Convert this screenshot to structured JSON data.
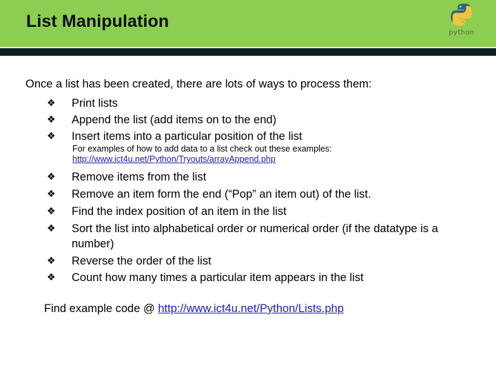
{
  "header": {
    "title": "List Manipulation",
    "band_color": "#8CCE52",
    "bar_color": "#0E1F24",
    "logo": {
      "name": "python-logo",
      "wordmark": "python"
    }
  },
  "slide": {
    "intro": "Once a list has been created, there are lots of ways to process them:",
    "bullet_glyph": "❖",
    "bullets_top": [
      "Print lists",
      "Append the list (add items on to the end)",
      "Insert items into a particular position of the list"
    ],
    "subnote": {
      "text": "For examples of how to add data to a list check out these examples:",
      "link": "http://www.ict4u.net/Python/Tryouts/arrayAppend.php"
    },
    "bullets_bottom": [
      "Remove items from the list",
      "Remove an item form the end (“Pop” an item out) of the list.",
      "Find the index position of an item in the list",
      "Sort the list into alphabetical order or numerical order (if the datatype is a number)",
      "Reverse the order of the list",
      "Count how many times a particular item appears in the list"
    ],
    "footer": {
      "prefix": "Find example code @ ",
      "link": "http://www.ict4u.net/Python/Lists.php"
    },
    "link_color": "#2020B0"
  }
}
